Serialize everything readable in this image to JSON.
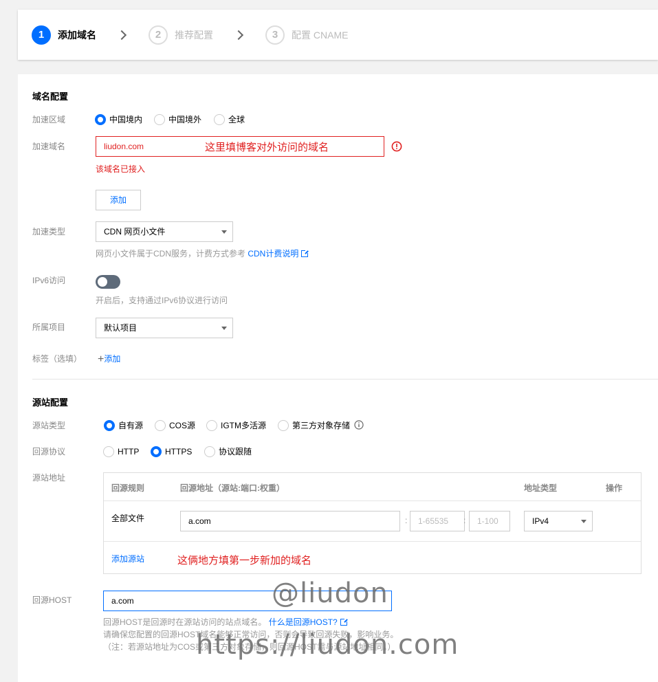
{
  "steps": [
    {
      "num": "1",
      "label": "添加域名"
    },
    {
      "num": "2",
      "label": "推荐配置"
    },
    {
      "num": "3",
      "label": "配置 CNAME"
    }
  ],
  "domain_config": {
    "title": "域名配置",
    "region_label": "加速区域",
    "region_options": [
      "中国境内",
      "中国境外",
      "全球"
    ],
    "region_selected": "中国境内",
    "domain_label": "加速域名",
    "domain_value": "liudon.com",
    "domain_error": "该域名已接入",
    "domain_annotation": "这里填博客对外访问的域名",
    "add_button": "添加",
    "type_label": "加速类型",
    "type_value": "CDN 网页小文件",
    "type_help": "网页小文件属于CDN服务，计费方式参考",
    "type_help_link": "CDN计费说明",
    "ipv6_label": "IPv6访问",
    "ipv6_help": "开启后，支持通过IPv6协议进行访问",
    "ipv6_enabled": false,
    "project_label": "所属项目",
    "project_value": "默认项目",
    "tag_label": "标签（选填）",
    "tag_add": "添加"
  },
  "origin_config": {
    "title": "源站配置",
    "origin_type_label": "源站类型",
    "origin_types": [
      "自有源",
      "COS源",
      "IGTM多活源",
      "第三方对象存储"
    ],
    "origin_type_selected": "自有源",
    "protocol_label": "回源协议",
    "protocols": [
      "HTTP",
      "HTTPS",
      "协议跟随"
    ],
    "protocol_selected": "HTTPS",
    "address_label": "源站地址",
    "table_headers": [
      "回源规则",
      "回源地址（源站:端口:权重）",
      "地址类型",
      "操作"
    ],
    "row_rule": "全部文件",
    "row_address": "a.com",
    "row_port_placeholder": "1-65535",
    "row_weight_placeholder": "1-100",
    "row_addr_type": "IPv4",
    "add_origin": "添加源站",
    "table_annotation": "这俩地方填第一步新加的域名",
    "host_label": "回源HOST",
    "host_value": "a.com",
    "host_help_1": "回源HOST是回源时在源站访问的站点域名。",
    "host_help_link": "什么是回源HOST?",
    "host_help_2": "请确保您配置的回源HOST域名能够正常访问，否则会导致回源失败，影响业务。",
    "host_help_3": "（注：若源站地址为COS或第三方对象存储，则回源HOST需与源站地址相同。）"
  },
  "watermarks": [
    "@liudon",
    "https://liudon.com"
  ],
  "colors": {
    "accent": "#006eff",
    "error": "#e02020"
  }
}
